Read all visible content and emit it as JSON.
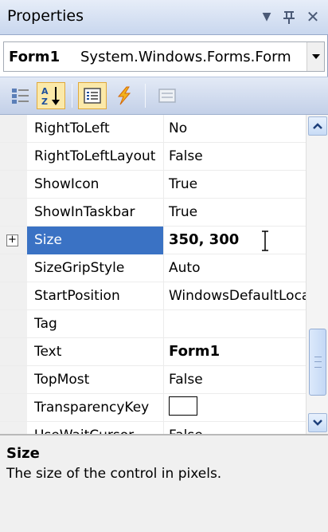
{
  "window": {
    "title": "Properties",
    "dropdown_glyph": "▼",
    "pin_glyph": "ф",
    "close_glyph": "✕"
  },
  "selector": {
    "object_name": "Form1",
    "object_type": "System.Windows.Forms.Form"
  },
  "toolbar": {
    "buttons": [
      {
        "icon": "categorized-icon",
        "checked": false
      },
      {
        "icon": "alphabetical-sort-icon",
        "checked": true
      },
      {
        "icon": "properties-icon",
        "checked": true
      },
      {
        "icon": "events-lightning-icon",
        "checked": false
      },
      {
        "icon": "property-pages-icon",
        "checked": false
      }
    ]
  },
  "properties": [
    {
      "name": "RightToLeft",
      "value": "No",
      "bold": false
    },
    {
      "name": "RightToLeftLayout",
      "value": "False",
      "bold": false
    },
    {
      "name": "ShowIcon",
      "value": "True",
      "bold": false
    },
    {
      "name": "ShowInTaskbar",
      "value": "True",
      "bold": false
    },
    {
      "name": "Size",
      "value": "350, 300",
      "bold": true,
      "selected": true,
      "expandable": true,
      "expander": "+"
    },
    {
      "name": "SizeGripStyle",
      "value": "Auto",
      "bold": false
    },
    {
      "name": "StartPosition",
      "value": "WindowsDefaultLocation",
      "bold": false
    },
    {
      "name": "Tag",
      "value": "",
      "bold": false
    },
    {
      "name": "Text",
      "value": "Form1",
      "bold": true
    },
    {
      "name": "TopMost",
      "value": "False",
      "bold": false
    },
    {
      "name": "TransparencyKey",
      "value": "",
      "bold": false,
      "swatch": "#ffffff"
    },
    {
      "name": "UseWaitCursor",
      "value": "False",
      "bold": false
    }
  ],
  "description": {
    "title": "Size",
    "text": "The size of the control in pixels."
  },
  "colors": {
    "selection": "#3a72c4",
    "toolbar_checked": "#fbe9a9"
  }
}
